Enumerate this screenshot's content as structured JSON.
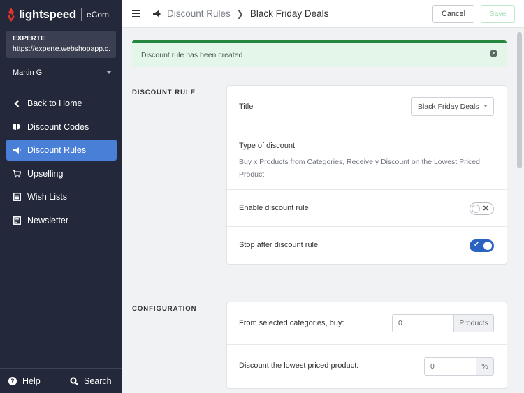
{
  "brand": {
    "name": "lightspeed",
    "product": "eCom",
    "color": "#e3322d"
  },
  "account": {
    "name": "EXPERTE",
    "url": "https://experte.webshopapp.c..."
  },
  "user": {
    "name": "Martin G"
  },
  "nav": [
    {
      "label": "Back to Home",
      "icon": "chevron-left-icon"
    },
    {
      "label": "Discount Codes",
      "icon": "tag-icon"
    },
    {
      "label": "Discount Rules",
      "icon": "megaphone-icon",
      "active": true
    },
    {
      "label": "Upselling",
      "icon": "cart-icon"
    },
    {
      "label": "Wish Lists",
      "icon": "list-icon"
    },
    {
      "label": "Newsletter",
      "icon": "newspaper-icon"
    }
  ],
  "bottom": {
    "help": "Help",
    "search": "Search"
  },
  "breadcrumb": {
    "parent": "Discount Rules",
    "current": "Black Friday Deals"
  },
  "toolbar": {
    "cancel": "Cancel",
    "save": "Save"
  },
  "alert": {
    "message": "Discount rule has been created",
    "color": "#27873f"
  },
  "discount_rule": {
    "section_label": "DISCOUNT RULE",
    "title_label": "Title",
    "title_value": "Black Friday Deals",
    "type_label": "Type of discount",
    "type_desc": "Buy  x  Products from Categories, Receive y Discount on the Lowest Priced Product",
    "enable_label": "Enable discount rule",
    "enable_on": false,
    "stop_label": "Stop after discount rule",
    "stop_on": true
  },
  "configuration": {
    "section_label": "CONFIGURATION",
    "buy_label": "From selected categories, buy:",
    "buy_value": "0",
    "buy_unit": "Products",
    "discount_label": "Discount the lowest priced product:",
    "discount_value": "0",
    "discount_unit": "%"
  }
}
